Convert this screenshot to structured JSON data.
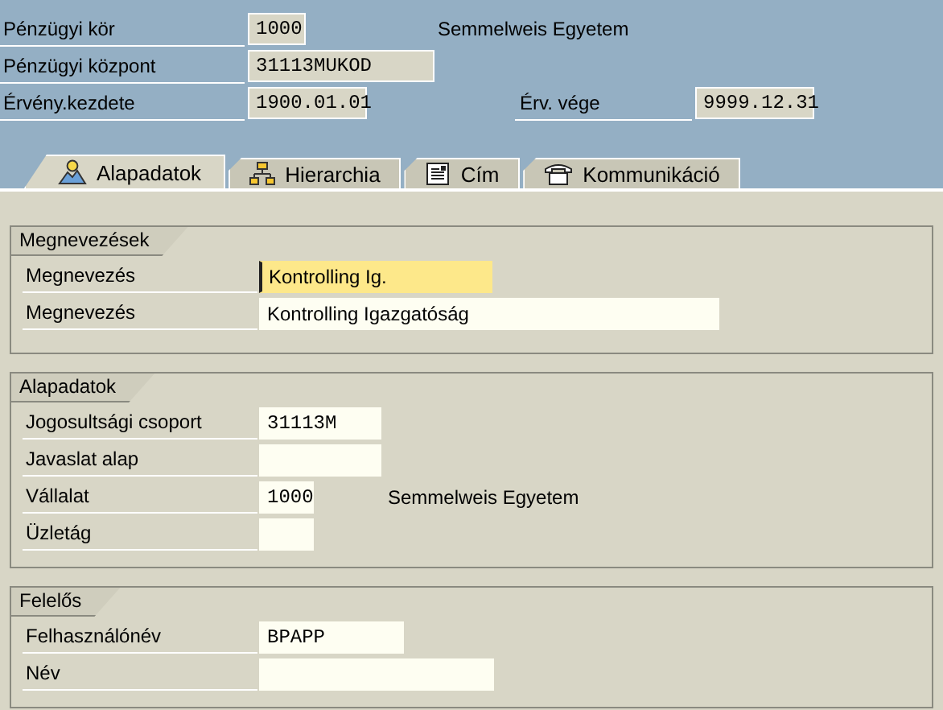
{
  "header": {
    "rows": [
      {
        "label": "Pénzügyi kör",
        "field": {
          "value": "1000",
          "kind": "code",
          "editable": false
        },
        "note": "Semmelweis Egyetem"
      },
      {
        "label": "Pénzügyi központ",
        "field": {
          "value": "31113MUKOD",
          "kind": "code",
          "editable": false
        }
      },
      {
        "label": "Érvény.kezdete",
        "field": {
          "value": "1900.01.01",
          "kind": "code",
          "editable": false
        },
        "label2": "Érv. vége",
        "field2": {
          "value": "9999.12.31",
          "kind": "code",
          "editable": false
        }
      }
    ]
  },
  "tabs": [
    {
      "label": "Alapadatok",
      "selected": true
    },
    {
      "label": "Hierarchia",
      "selected": false
    },
    {
      "label": "Cím",
      "selected": false
    },
    {
      "label": "Kommunikáció",
      "selected": false
    }
  ],
  "groups": [
    {
      "title": "Megnevezések",
      "rows": [
        {
          "label": "Megnevezés",
          "field": {
            "value": "Kontrolling Ig.",
            "kind": "text",
            "editable": true,
            "focused": true
          }
        },
        {
          "label": "Megnevezés",
          "field": {
            "value": "Kontrolling Igazgatóság",
            "kind": "text",
            "editable": true,
            "focused": false
          }
        }
      ]
    },
    {
      "title": "Alapadatok",
      "rows": [
        {
          "label": "Jogosultsági csoport",
          "field": {
            "value": "31113M",
            "kind": "code",
            "editable": true,
            "focused": false
          }
        },
        {
          "label": "Javaslat alap",
          "field": {
            "kind": "code",
            "editable": true,
            "focused": false
          }
        },
        {
          "label": "Vállalat",
          "field": {
            "value": "1000",
            "kind": "code",
            "editable": true,
            "focused": false
          },
          "note": "Semmelweis Egyetem"
        },
        {
          "label": "Üzletág",
          "field": {
            "kind": "code",
            "editable": true,
            "focused": false
          }
        }
      ]
    },
    {
      "title": "Felelős",
      "rows": [
        {
          "label": "Felhasználónév",
          "field": {
            "value": "BPAPP",
            "kind": "code",
            "editable": true,
            "focused": false
          }
        },
        {
          "label": "Név",
          "field": {
            "kind": "text",
            "editable": true,
            "focused": false
          }
        }
      ]
    }
  ]
}
